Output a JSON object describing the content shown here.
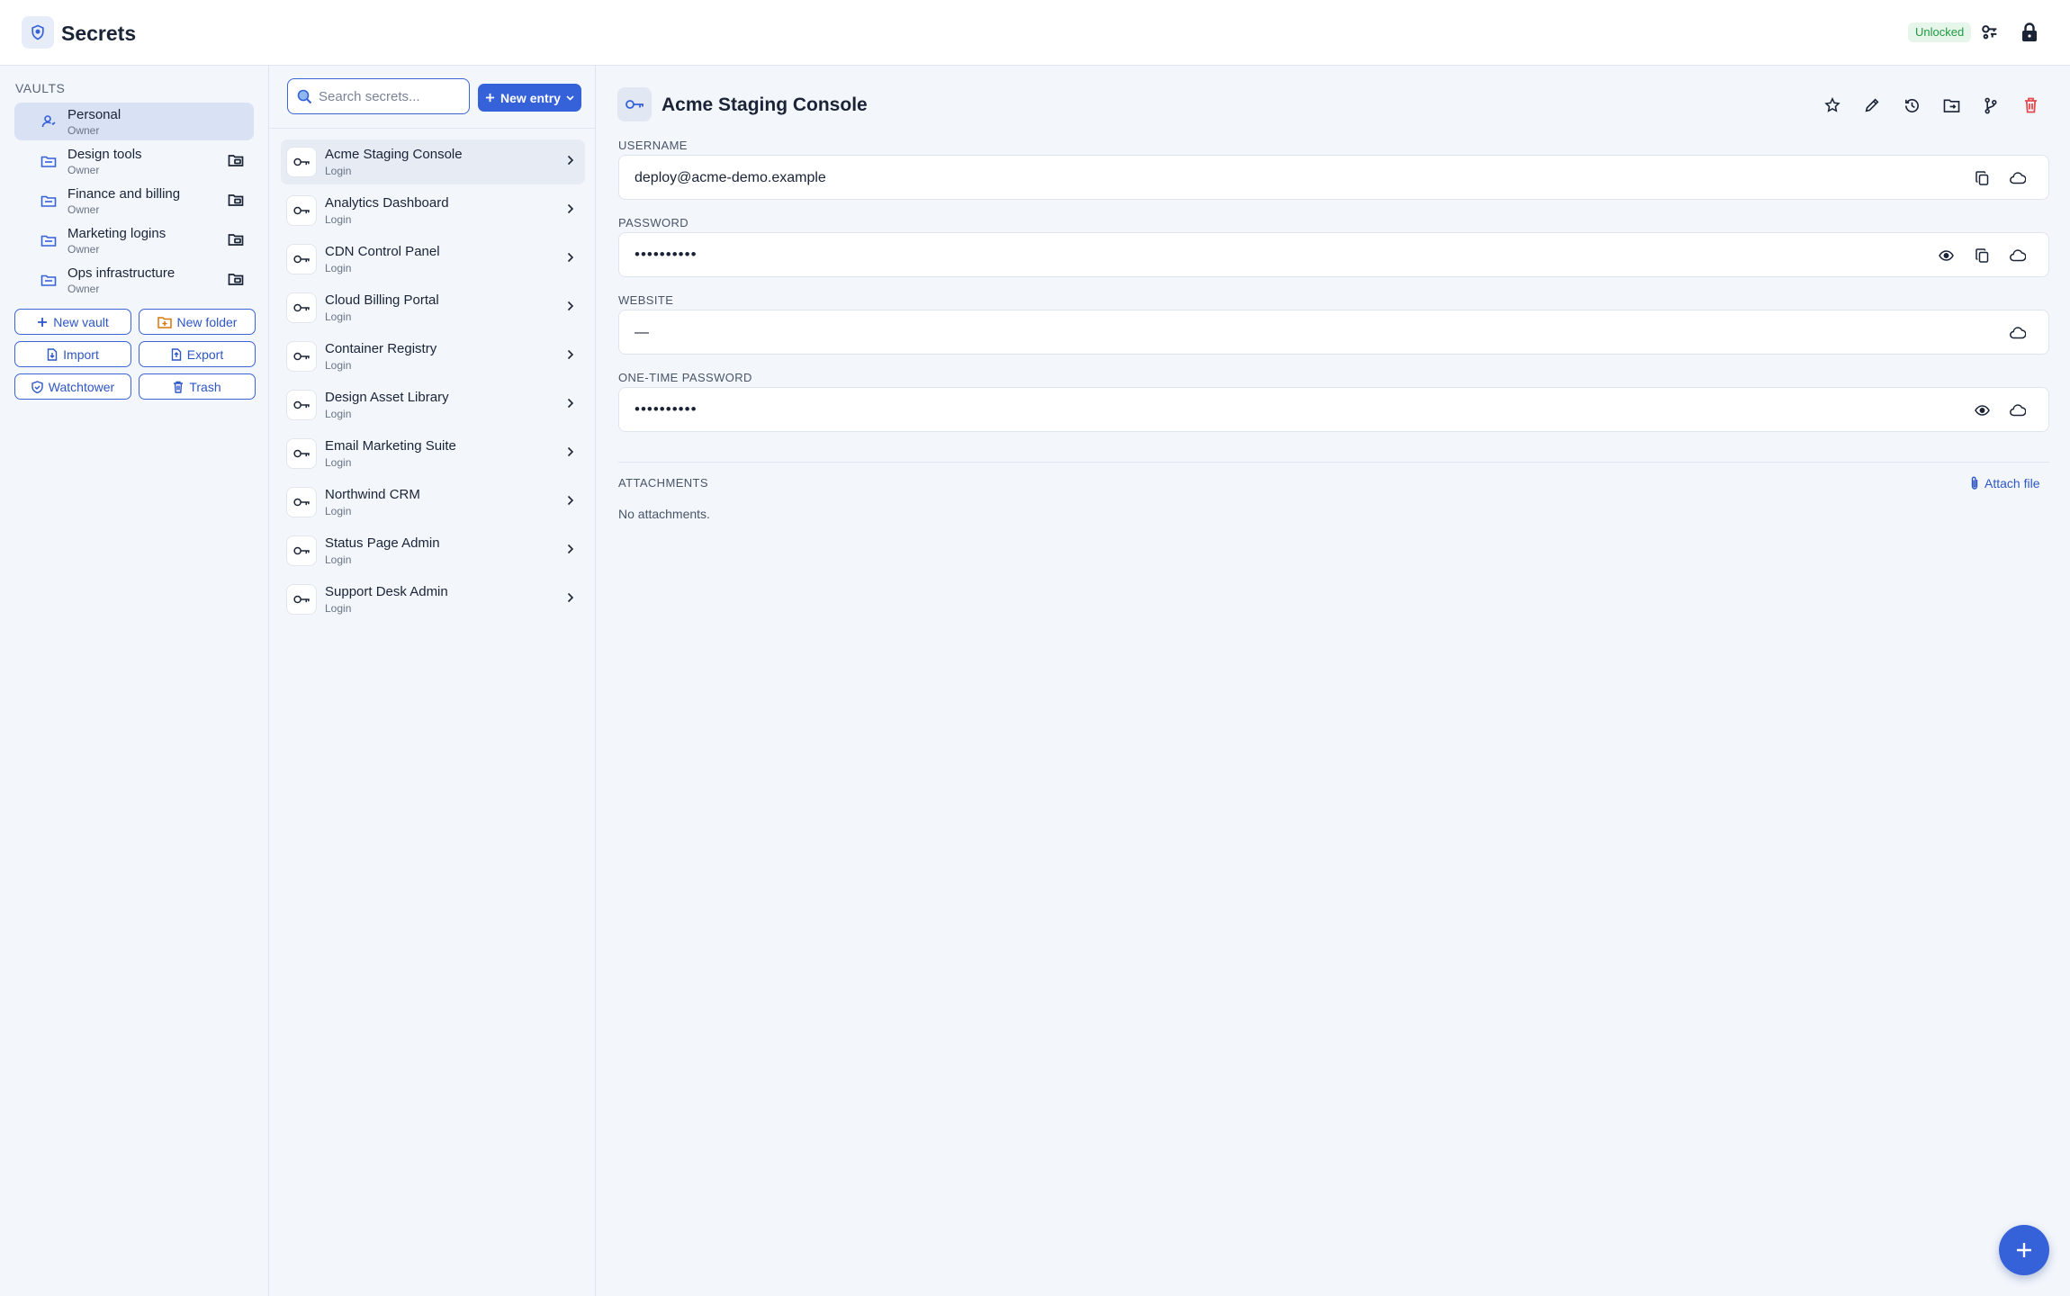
{
  "app": {
    "title": "Secrets",
    "status": "Unlocked"
  },
  "colors": {
    "accent": "#3561d9",
    "success": "#1f9a43",
    "danger": "#e5484d",
    "folder": "#d97706"
  },
  "sidebar": {
    "section_label": "VAULTS",
    "vaults": [
      {
        "name": "Personal",
        "role": "Owner",
        "icon": "person-icon",
        "active": true
      },
      {
        "name": "Design tools",
        "role": "Owner",
        "icon": "folder-icon"
      },
      {
        "name": "Finance and billing",
        "role": "Owner",
        "icon": "folder-icon"
      },
      {
        "name": "Marketing logins",
        "role": "Owner",
        "icon": "folder-icon"
      },
      {
        "name": "Ops infrastructure",
        "role": "Owner",
        "icon": "folder-icon"
      }
    ],
    "buttons": {
      "new_vault": "New vault",
      "new_folder": "New folder",
      "import": "Import",
      "export": "Export",
      "watchtower": "Watchtower",
      "trash": "Trash"
    }
  },
  "list": {
    "search_placeholder": "Search secrets...",
    "new_entry_label": "New entry",
    "entries": [
      {
        "name": "Acme Staging Console",
        "type": "Login",
        "active": true
      },
      {
        "name": "Analytics Dashboard",
        "type": "Login"
      },
      {
        "name": "CDN Control Panel",
        "type": "Login"
      },
      {
        "name": "Cloud Billing Portal",
        "type": "Login"
      },
      {
        "name": "Container Registry",
        "type": "Login"
      },
      {
        "name": "Design Asset Library",
        "type": "Login"
      },
      {
        "name": "Email Marketing Suite",
        "type": "Login"
      },
      {
        "name": "Northwind CRM",
        "type": "Login"
      },
      {
        "name": "Status Page Admin",
        "type": "Login"
      },
      {
        "name": "Support Desk Admin",
        "type": "Login"
      }
    ]
  },
  "detail": {
    "title": "Acme Staging Console",
    "fields": {
      "username": {
        "label": "USERNAME",
        "value": "deploy@acme-demo.example"
      },
      "password": {
        "label": "PASSWORD",
        "value": "••••••••••"
      },
      "website": {
        "label": "WEBSITE",
        "value": "—"
      },
      "otp": {
        "label": "ONE-TIME PASSWORD",
        "value": "••••••••••"
      }
    },
    "attachments": {
      "label": "ATTACHMENTS",
      "attach_label": "Attach file",
      "empty_text": "No attachments."
    }
  }
}
